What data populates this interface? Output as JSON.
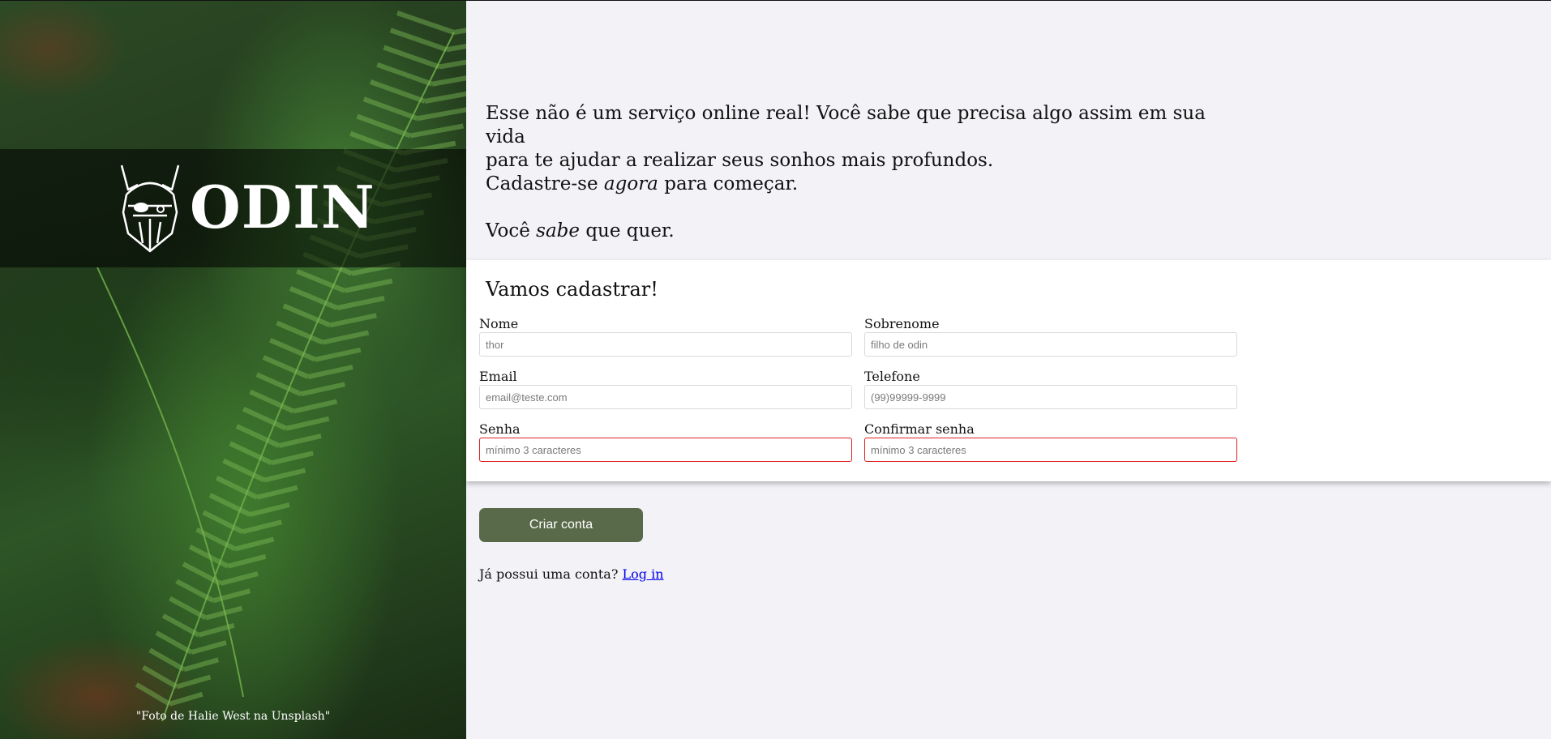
{
  "brand": {
    "name": "ODIN",
    "icon": "viking-helmet-icon"
  },
  "photo_credit": "\"Foto de Halie West na Unsplash\"",
  "intro": {
    "line1": "Esse não é um serviço online real! Você sabe que precisa algo assim em sua vida",
    "line2": "para te ajudar a realizar seus sonhos mais profundos.",
    "line3_before": "Cadastre-se ",
    "line3_em": "agora",
    "line3_after": " para começar.",
    "line4_before": "Você ",
    "line4_em": "sabe",
    "line4_after": " que quer."
  },
  "form": {
    "title": "Vamos cadastrar!",
    "fields": {
      "first_name": {
        "label": "Nome",
        "placeholder": "thor"
      },
      "last_name": {
        "label": "Sobrenome",
        "placeholder": "filho de odin"
      },
      "email": {
        "label": "Email",
        "placeholder": "email@teste.com"
      },
      "phone": {
        "label": "Telefone",
        "placeholder": "(99)99999-9999"
      },
      "password": {
        "label": "Senha",
        "placeholder": "mínimo 3 caracteres"
      },
      "confirm_password": {
        "label": "Confirmar senha",
        "placeholder": "mínimo 3 caracteres"
      }
    },
    "invalid_border_color": "#e02020"
  },
  "actions": {
    "create_label": "Criar conta",
    "login_prompt": "Já possui uma conta?",
    "login_link": "Log in",
    "button_color": "#596a4a"
  }
}
